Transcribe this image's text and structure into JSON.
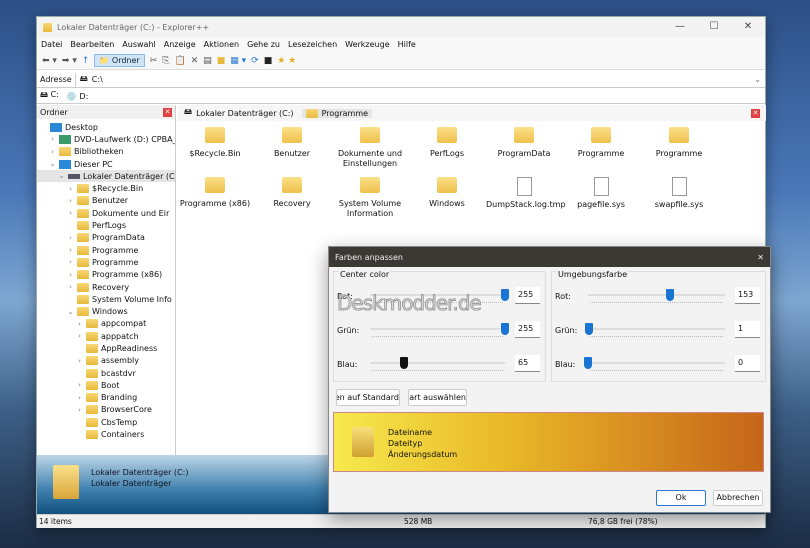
{
  "window": {
    "title": "Lokaler Datenträger (C:) - Explorer++",
    "controls": [
      "—",
      "☐",
      "✕"
    ]
  },
  "menu": [
    "Datei",
    "Bearbeiten",
    "Auswahl",
    "Anzeige",
    "Aktionen",
    "Gehe zu",
    "Lesezeichen",
    "Werkzeuge",
    "Hilfe"
  ],
  "toolbar": {
    "ordner_label": "Ordner",
    "icons": [
      "back-icon",
      "forward-icon",
      "up-icon",
      "folders-icon",
      "cut-icon",
      "copy-icon",
      "paste-icon",
      "delete-icon",
      "properties-icon",
      "views-icon",
      "refresh-icon",
      "cmd-icon",
      "bookmark-icon"
    ]
  },
  "address": {
    "label": "Adresse",
    "value": "C:\\"
  },
  "drives": [
    "C:",
    "D:"
  ],
  "tree": {
    "header": "Ordner",
    "items": [
      {
        "label": "Desktop",
        "level": 0,
        "icon": "pc"
      },
      {
        "label": "DVD-Laufwerk (D:) CPBA_X",
        "level": 1,
        "arrow": ">",
        "icon": "dvd"
      },
      {
        "label": "Bibliotheken",
        "level": 1,
        "arrow": ">",
        "icon": "folder"
      },
      {
        "label": "Dieser PC",
        "level": 1,
        "arrow": "v",
        "icon": "pc"
      },
      {
        "label": "Lokaler Datenträger (C:)",
        "level": 2,
        "arrow": "v",
        "icon": "drive",
        "selected": true
      },
      {
        "label": "$Recycle.Bin",
        "level": 3,
        "arrow": ">"
      },
      {
        "label": "Benutzer",
        "level": 3,
        "arrow": ">"
      },
      {
        "label": "Dokumente und Eir",
        "level": 3,
        "arrow": ">"
      },
      {
        "label": "PerfLogs",
        "level": 3
      },
      {
        "label": "ProgramData",
        "level": 3,
        "arrow": ">"
      },
      {
        "label": "Programme",
        "level": 3,
        "arrow": ">"
      },
      {
        "label": "Programme",
        "level": 3,
        "arrow": ">"
      },
      {
        "label": "Programme (x86)",
        "level": 3,
        "arrow": ">"
      },
      {
        "label": "Recovery",
        "level": 3,
        "arrow": ">"
      },
      {
        "label": "System Volume Info",
        "level": 3
      },
      {
        "label": "Windows",
        "level": 3,
        "arrow": "v"
      },
      {
        "label": "appcompat",
        "level": 4,
        "arrow": ">"
      },
      {
        "label": "apppatch",
        "level": 4,
        "arrow": ">"
      },
      {
        "label": "AppReadiness",
        "level": 4
      },
      {
        "label": "assembly",
        "level": 4,
        "arrow": ">"
      },
      {
        "label": "bcastdvr",
        "level": 4
      },
      {
        "label": "Boot",
        "level": 4,
        "arrow": ">"
      },
      {
        "label": "Branding",
        "level": 4,
        "arrow": ">"
      },
      {
        "label": "BrowserCore",
        "level": 4,
        "arrow": ">"
      },
      {
        "label": "CbsTemp",
        "level": 4
      },
      {
        "label": "Containers",
        "level": 4
      }
    ]
  },
  "tabs": [
    "Lokaler Datenträger (C:)",
    "Programme"
  ],
  "files": [
    {
      "name": "$Recycle.Bin",
      "type": "folder"
    },
    {
      "name": "Benutzer",
      "type": "folder"
    },
    {
      "name": "Dokumente und Einstellungen",
      "type": "folder"
    },
    {
      "name": "PerfLogs",
      "type": "folder"
    },
    {
      "name": "ProgramData",
      "type": "folder"
    },
    {
      "name": "Programme",
      "type": "folder"
    },
    {
      "name": "Programme",
      "type": "folder"
    },
    {
      "name": "Programme (x86)",
      "type": "folder"
    },
    {
      "name": "Recovery",
      "type": "folder"
    },
    {
      "name": "System Volume Information",
      "type": "folder"
    },
    {
      "name": "Windows",
      "type": "folder"
    },
    {
      "name": "DumpStack.log.tmp",
      "type": "file"
    },
    {
      "name": "pagefile.sys",
      "type": "file"
    },
    {
      "name": "swapfile.sys",
      "type": "file"
    }
  ],
  "display": {
    "line1": "Lokaler Datenträger (C:)",
    "line2": "Lokaler Datenträger"
  },
  "status": {
    "items": "14 items",
    "size": "528 MB",
    "free": "76,8 GB frei (78%)"
  },
  "dialog": {
    "title": "Farben anpassen",
    "close": "✕",
    "watermark": "Deskmodder.de",
    "center": {
      "label": "Center color",
      "sliders": [
        {
          "label": "Rot:",
          "value": "255",
          "max": 255
        },
        {
          "label": "Grün:",
          "value": "255",
          "max": 255
        },
        {
          "label": "Blau:",
          "value": "65",
          "max": 255
        }
      ]
    },
    "surround": {
      "label": "Umgebungsfarbe",
      "sliders": [
        {
          "label": "Rot:",
          "value": "153",
          "max": 255
        },
        {
          "label": "Grün:",
          "value": "1",
          "max": 255
        },
        {
          "label": "Blau:",
          "value": "0",
          "max": 255
        }
      ]
    },
    "reset_label": "ücksetzen auf Standard",
    "font_label": "Schriftart auswählen",
    "preview": {
      "name": "Dateiname",
      "type": "Dateityp",
      "date": "Änderungsdatum",
      "center_color": "#ffff41",
      "surround_color": "#990100"
    },
    "ok": "Ok",
    "cancel": "Abbrechen"
  }
}
